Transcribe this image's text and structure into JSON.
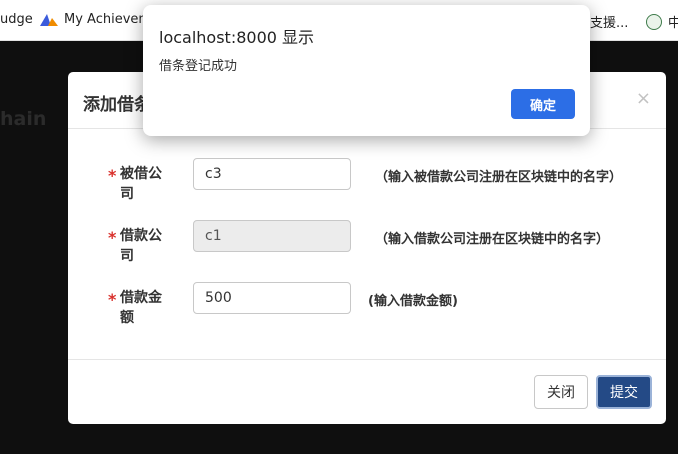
{
  "bookmarks": {
    "items": [
      {
        "label": "udge"
      },
      {
        "label": "My Achieveme",
        "icon": "achievement-icon"
      },
      {
        "label": "支援..."
      },
      {
        "label": "中",
        "icon": "seal-icon"
      }
    ]
  },
  "page": {
    "background_text": "hain"
  },
  "alert": {
    "title": "localhost:8000 显示",
    "message": "借条登记成功",
    "ok_label": "确定"
  },
  "modal": {
    "title": "添加借条",
    "close_glyph": "×",
    "fields": [
      {
        "label": "被借公司",
        "value": "c3",
        "hint": "（输入被借款公司注册在区块链中的名字）",
        "readonly": false
      },
      {
        "label": "借款公司",
        "value": "c1",
        "hint": "（输入借款公司注册在区块链中的名字）",
        "readonly": true
      },
      {
        "label": "借款金额",
        "value": "500",
        "hint": "(输入借款金额)",
        "readonly": false
      }
    ],
    "required_mark": "*",
    "close_button_label": "关闭",
    "submit_button_label": "提交"
  },
  "colors": {
    "overlay": "#0f0f0f",
    "primary": "#244a86",
    "alert_button": "#2c6ee6",
    "required": "#d9302b"
  }
}
